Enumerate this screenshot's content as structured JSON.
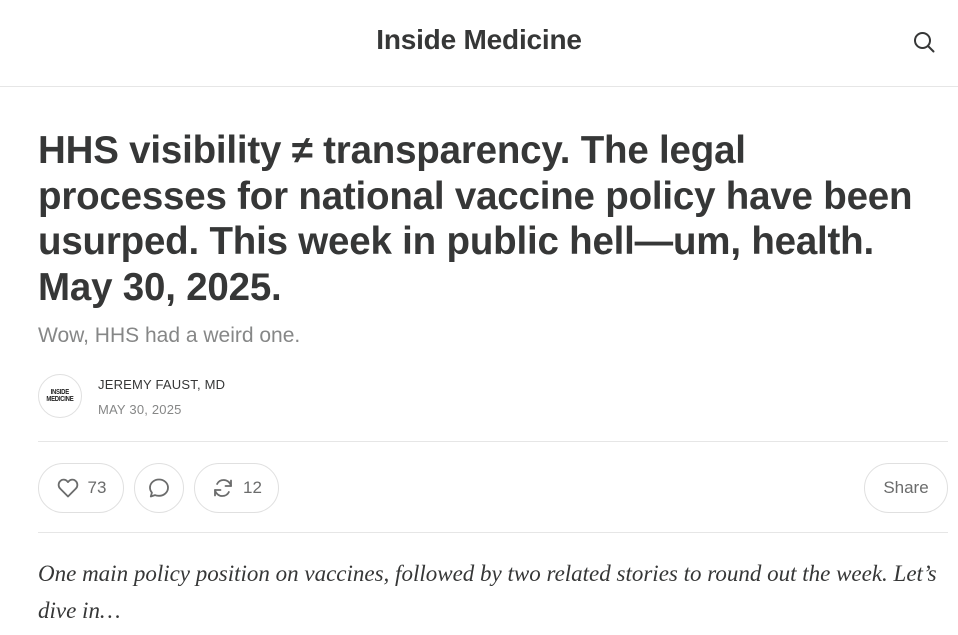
{
  "header": {
    "site_title": "Inside Medicine",
    "search_icon": "search-icon"
  },
  "post": {
    "title": "HHS visibility ≠ transparency. The legal processes for national vaccine policy have been usurped. This week in public hell—um, health. May 30, 2025.",
    "subtitle": "Wow, HHS had a weird one.",
    "avatar_text": [
      "INSIDE",
      "MEDICINE"
    ],
    "author": "JEREMY FAUST, MD",
    "date": "MAY 30, 2025"
  },
  "actions": {
    "like_icon": "heart-icon",
    "like_count": "73",
    "comment_icon": "comment-bubble-icon",
    "restack_icon": "restack-icon",
    "restack_count": "12",
    "share_label": "Share"
  },
  "body": {
    "intro": "One main policy position on vaccines, followed by two related stories to round out the week. Let’s dive in…"
  },
  "colors": {
    "text": "#363737",
    "muted": "#868787",
    "border": "#e6e6e6"
  }
}
